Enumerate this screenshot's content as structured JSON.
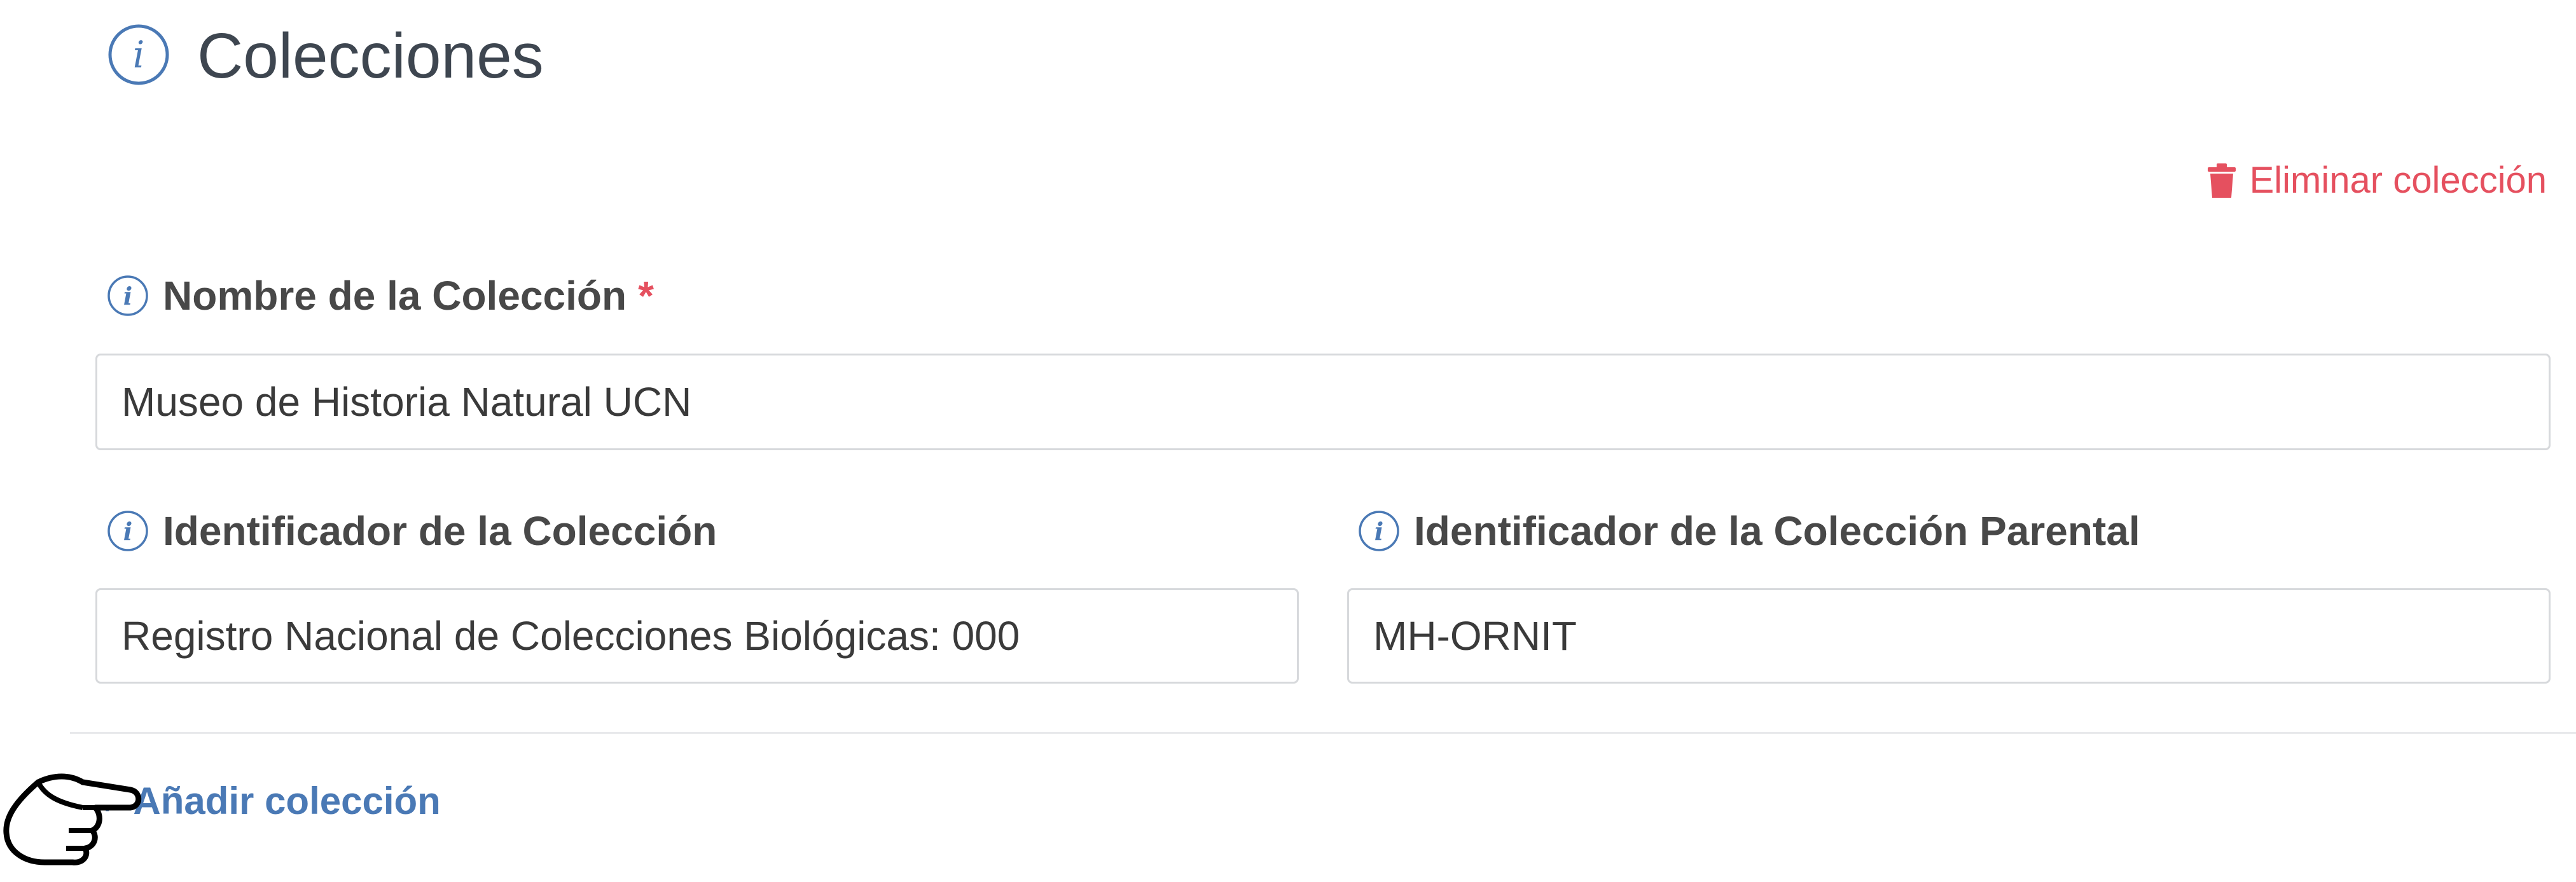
{
  "header": {
    "title": "Colecciones",
    "icon": "info-icon"
  },
  "actions": {
    "delete_label": "Eliminar colección",
    "delete_icon": "trash-icon",
    "add_label": "Añadir colección",
    "add_symbol": "+"
  },
  "fields": {
    "name": {
      "label": "Nombre de la Colección",
      "required_mark": "*",
      "value": "Museo de Historia Natural UCN"
    },
    "identifier": {
      "label": "Identificador de la Colección",
      "value": "Registro Nacional de Colecciones Biológicas: 000"
    },
    "parent_identifier": {
      "label": "Identificador de la Colección Parental",
      "value": "MH-ORNIT"
    }
  },
  "colors": {
    "accent": "#4a79b5",
    "danger": "#e5505f",
    "text": "#484848",
    "border": "#d7d9dc"
  }
}
